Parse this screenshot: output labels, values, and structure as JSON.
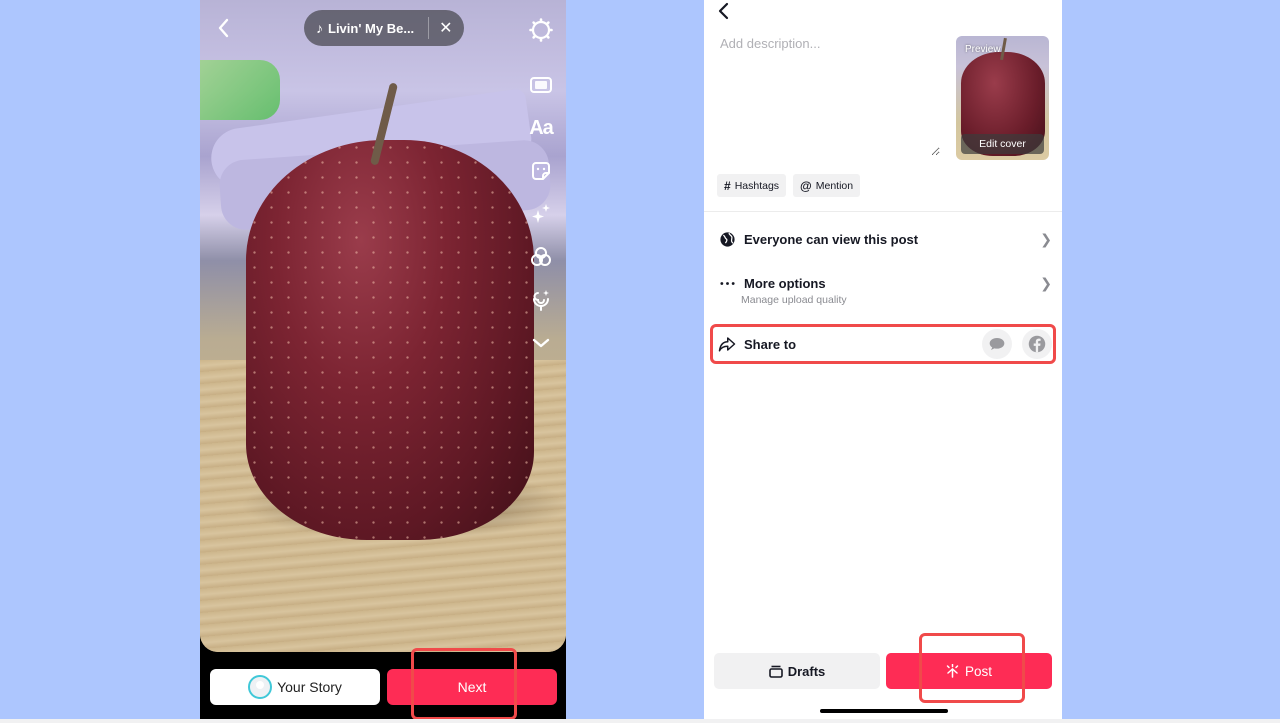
{
  "editor": {
    "back_icon": "chevron-left-icon",
    "music": {
      "icon": "music-note-icon",
      "title": "Livin' My Be...",
      "close_icon": "close-icon"
    },
    "tools": [
      {
        "name": "settings",
        "icon": "gear-icon"
      },
      {
        "name": "flip",
        "icon": "crop-icon"
      },
      {
        "name": "text",
        "icon": "text-icon",
        "label": "Aa"
      },
      {
        "name": "stickers",
        "icon": "sticker-icon"
      },
      {
        "name": "effects",
        "icon": "sparkle-icon"
      },
      {
        "name": "filters",
        "icon": "filters-icon"
      },
      {
        "name": "voice",
        "icon": "voice-effects-icon"
      },
      {
        "name": "more",
        "icon": "chevron-down-icon"
      }
    ],
    "your_story_label": "Your Story",
    "next_label": "Next"
  },
  "post": {
    "back_icon": "chevron-left-icon",
    "description_placeholder": "Add description...",
    "description_value": "",
    "cover": {
      "preview_label": "Preview",
      "edit_cover_label": "Edit cover"
    },
    "chips": [
      {
        "symbol": "#",
        "label": "Hashtags"
      },
      {
        "symbol": "@",
        "label": "Mention"
      }
    ],
    "privacy": {
      "label": "Everyone can view this post",
      "icon": "globe-icon"
    },
    "more_options": {
      "label": "More options",
      "sublabel": "Manage upload quality",
      "icon": "more-dots-icon"
    },
    "share_to": {
      "label": "Share to",
      "icon": "share-icon",
      "targets": [
        "message-icon",
        "facebook-icon"
      ]
    },
    "drafts_label": "Drafts",
    "post_label": "Post"
  },
  "colors": {
    "accent": "#fe2c55",
    "highlight": "#f04a4a",
    "background": "#adc6fe"
  }
}
